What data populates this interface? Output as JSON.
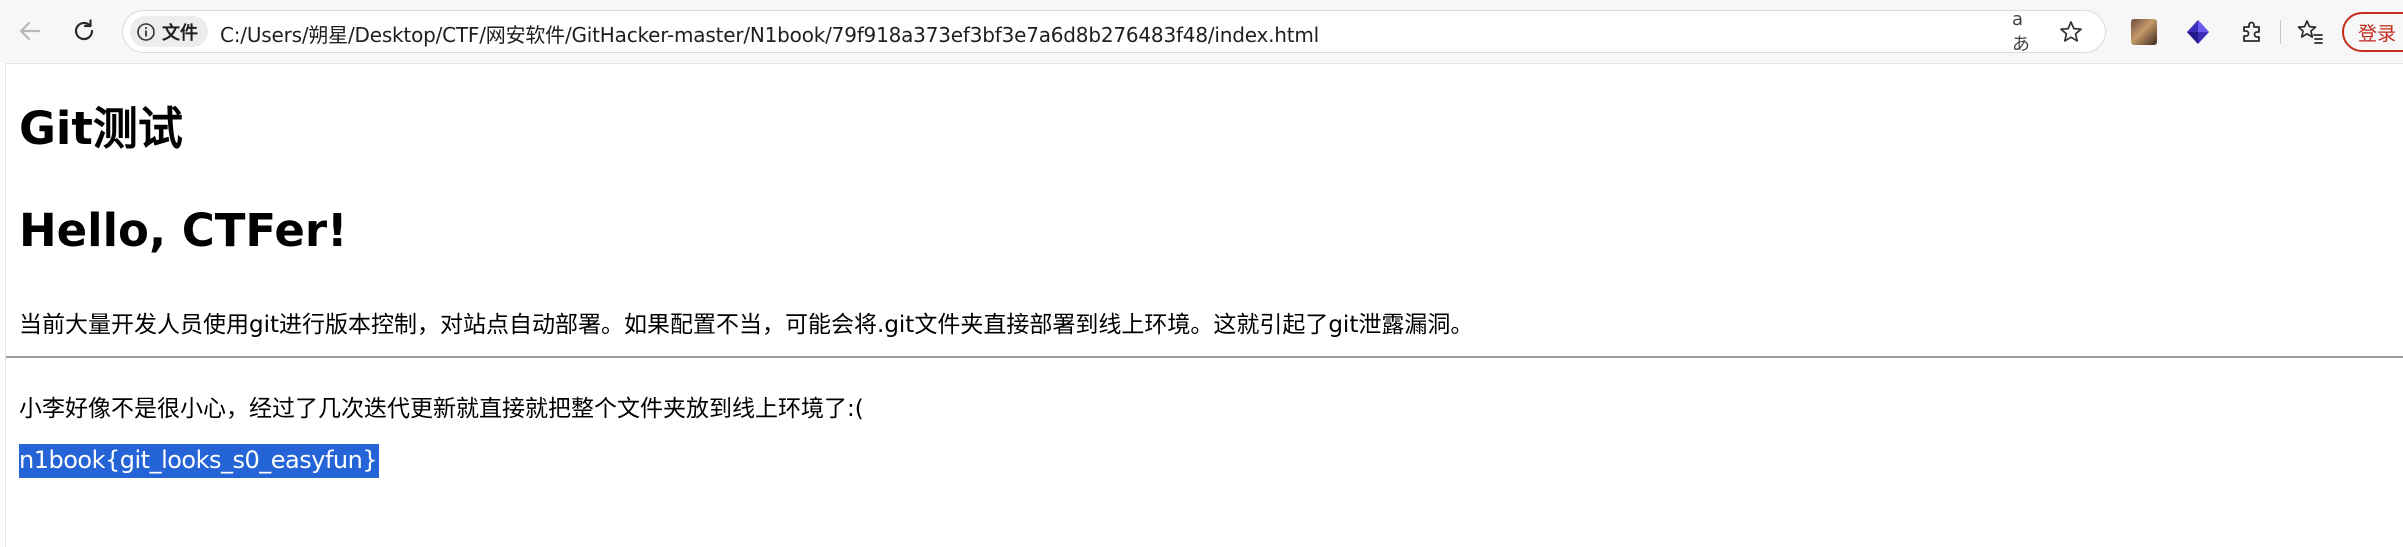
{
  "browser": {
    "site_chip_label": "文件",
    "url": "C:/Users/朔星/Desktop/CTF/网安软件/GitHacker-master/N1book/79f918a373ef3bf3e7a6d8b276483f48/index.html",
    "read_aloud_glyph": "aあ",
    "login_label": "登录",
    "icons": {
      "back": "arrow-left-icon",
      "reload": "reload-icon",
      "site_info": "info-icon",
      "read_aloud": "read-aloud-icon",
      "favorite": "star-icon",
      "extension_avatar": "avatar-icon",
      "extension_cube": "cube-icon",
      "extensions": "puzzle-icon",
      "favorites": "favorites-icon"
    },
    "accent_color": "#c42b1c"
  },
  "page": {
    "heading1": "Git测试",
    "heading2": "Hello, CTFer!",
    "paragraph1": "当前大量开发人员使用git进行版本控制，对站点自动部署。如果配置不当，可能会将.git文件夹直接部署到线上环境。这就引起了git泄露漏洞。",
    "paragraph2": "小李好像不是很小心，经过了几次迭代更新就直接就把整个文件夹放到线上环境了:(",
    "flag": "n1book{git_looks_s0_easyfun}",
    "selection_color": "#2464d6"
  }
}
